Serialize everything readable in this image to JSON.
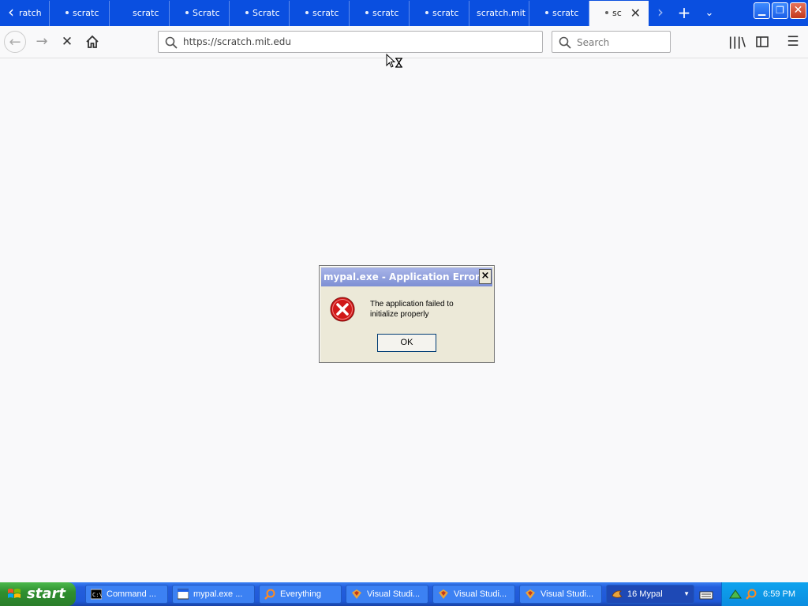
{
  "browser": {
    "tabs": [
      {
        "label": "ratch",
        "active": false
      },
      {
        "label": "scratc",
        "active": false
      },
      {
        "label": "scratc",
        "active": false
      },
      {
        "label": "Scratc",
        "active": false
      },
      {
        "label": "Scratc",
        "active": false
      },
      {
        "label": "scratc",
        "active": false
      },
      {
        "label": "scratc",
        "active": false
      },
      {
        "label": "scratc",
        "active": false
      },
      {
        "label": "scratch.mit",
        "active": false
      },
      {
        "label": "scratc",
        "active": false
      },
      {
        "label": "sc",
        "active": true
      }
    ],
    "url": "https://scratch.mit.edu",
    "search_placeholder": "Search"
  },
  "dialog": {
    "title": "mypal.exe - Application Error",
    "message": "The application failed to initialize properly",
    "ok_label": "OK"
  },
  "taskbar": {
    "start_label": "start",
    "items": [
      {
        "label": "Command ...",
        "icon": "cmd-icon"
      },
      {
        "label": "mypal.exe ...",
        "icon": "window-icon"
      },
      {
        "label": "Everything",
        "icon": "magnifier-icon"
      },
      {
        "label": "Visual Studi...",
        "icon": "visual-studio-icon"
      },
      {
        "label": "Visual Studi...",
        "icon": "visual-studio-icon"
      },
      {
        "label": "Visual Studi...",
        "icon": "visual-studio-icon"
      },
      {
        "label": "16 Mypal",
        "icon": "mypal-icon"
      }
    ],
    "clock": "6:59 PM"
  },
  "colors": {
    "tabstrip": "#0a4fe0",
    "taskbar": "#245edc",
    "error_red": "#d11818"
  }
}
